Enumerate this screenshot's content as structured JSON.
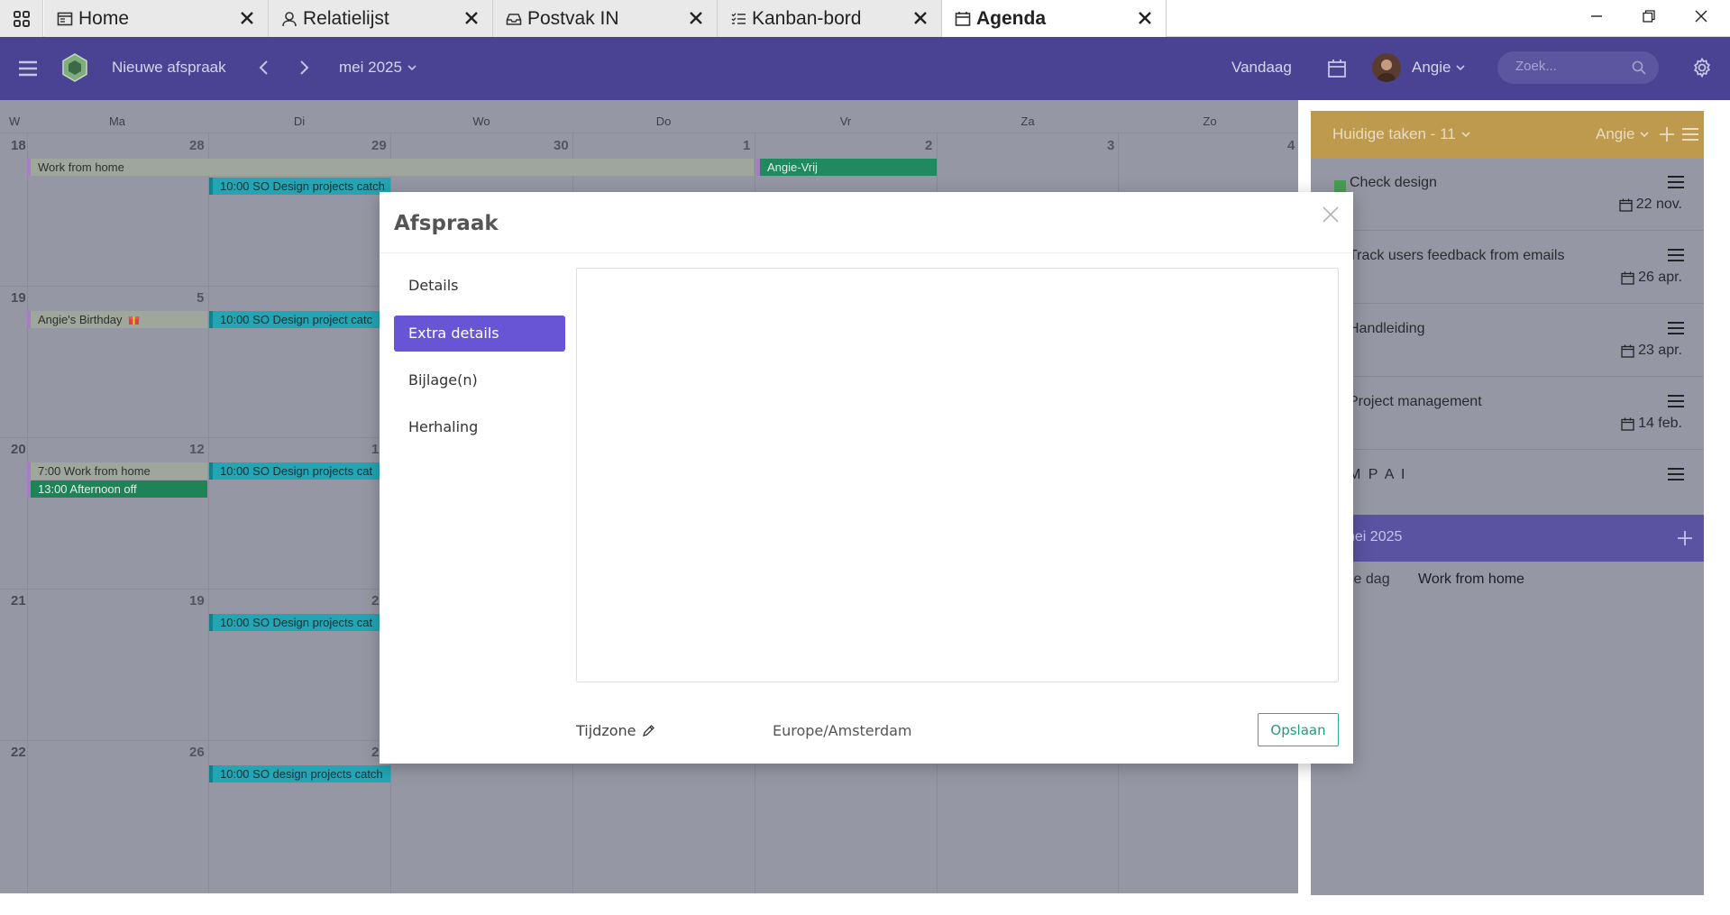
{
  "tabs": [
    {
      "label": "Home",
      "icon": "home-icon"
    },
    {
      "label": "Relatielijst",
      "icon": "person-icon"
    },
    {
      "label": "Postvak IN",
      "icon": "inbox-icon"
    },
    {
      "label": "Kanban-bord",
      "icon": "list-icon"
    },
    {
      "label": "Agenda",
      "icon": "calendar-icon"
    }
  ],
  "header": {
    "new_appointment": "Nieuwe afspraak",
    "month": "mei 2025",
    "today": "Vandaag",
    "user": "Angie",
    "search_placeholder": "Zoek..."
  },
  "calendar": {
    "weekday_headers": [
      "W",
      "Ma",
      "Di",
      "Wo",
      "Do",
      "Vr",
      "Za",
      "Zo"
    ],
    "weeks": [
      {
        "week": "18",
        "days": [
          "28",
          "29",
          "30",
          "1",
          "2",
          "3",
          "4"
        ]
      },
      {
        "week": "19",
        "days": [
          "5"
        ]
      },
      {
        "week": "20",
        "days": [
          "12",
          "1"
        ]
      },
      {
        "week": "21",
        "days": [
          "19",
          "2"
        ]
      },
      {
        "week": "22",
        "days": [
          "26",
          "2"
        ]
      }
    ],
    "events": {
      "work_from_home_1": "Work from home",
      "angie_vrij": "Angie-Vrij",
      "design_1": "10:00 SO Design projects catch",
      "birthday": "Angie's Birthday",
      "design_2": "10:00 SO Design project catc",
      "work_from_home_2": "7:00 Work from home",
      "afternoon_off": "13:00 Afternoon off",
      "design_3": "10:00 SO Design projects cat",
      "design_4": "10:00 SO Design projects cat",
      "design_5": "10:00 SO design projects catch"
    }
  },
  "tasks_panel": {
    "title": "Huidige taken - 11",
    "user": "Angie",
    "items": [
      {
        "title": "Check design",
        "date": "22 nov."
      },
      {
        "title": "Track users feedback from emails",
        "date": "26 apr."
      },
      {
        "title": "Handleiding",
        "date": "23 apr."
      },
      {
        "title": "Project management",
        "date": "14 feb."
      },
      {
        "title": "M P A I",
        "date": ""
      }
    ]
  },
  "day_panel": {
    "title": "nei 2025",
    "row_label": "le dag",
    "row_value": "Work from home"
  },
  "modal": {
    "title": "Afspraak",
    "nav": [
      "Details",
      "Extra details",
      "Bijlage(n)",
      "Herhaling"
    ],
    "active_nav": "Extra details",
    "timezone_label": "Tijdzone",
    "timezone_value": "Europe/Amsterdam",
    "save": "Opslaan"
  },
  "colors": {
    "header": "#4a4394",
    "accent": "#6755d6",
    "tasks_header": "#bd9a4e",
    "save": "#26b08a"
  }
}
